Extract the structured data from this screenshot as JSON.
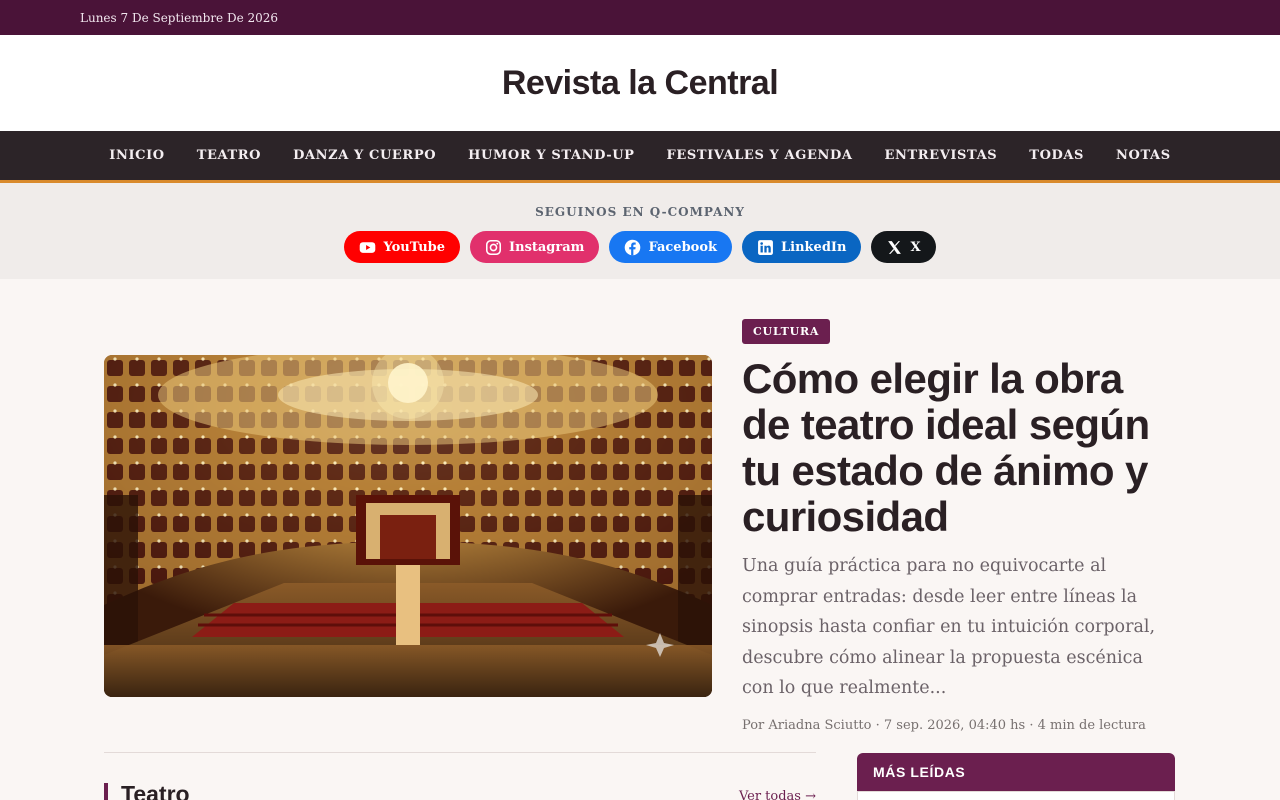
{
  "topbar": {
    "date": "Lunes 7 De Septiembre De 2026"
  },
  "site": {
    "title": "Revista la Central"
  },
  "nav": {
    "items": [
      "INICIO",
      "TEATRO",
      "DANZA Y CUERPO",
      "HUMOR Y STAND-UP",
      "FESTIVALES Y AGENDA",
      "ENTREVISTAS",
      "TODAS",
      "NOTAS"
    ]
  },
  "social": {
    "heading": "SEGUINOS EN Q-COMPANY",
    "links": [
      {
        "label": "YouTube",
        "icon": "youtube-icon",
        "color": "#ff0000"
      },
      {
        "label": "Instagram",
        "icon": "instagram-icon",
        "color": "#e1306c"
      },
      {
        "label": "Facebook",
        "icon": "facebook-icon",
        "color": "#1877f2"
      },
      {
        "label": "LinkedIn",
        "icon": "linkedin-icon",
        "color": "#0a66c2"
      },
      {
        "label": "X",
        "icon": "x-icon",
        "color": "#14171a"
      }
    ]
  },
  "hero": {
    "category": "CULTURA",
    "title": "Cómo elegir la obra de teatro ideal según tu estado de ánimo y curiosidad",
    "excerpt": "Una guía práctica para no equivocarte al comprar entradas: desde leer entre líneas la sinopsis hasta confiar en tu intuición corporal, descubre cómo alinear la propuesta escénica con lo que realmente...",
    "byline": "Por Ariadna Sciutto · 7 sep. 2026, 04:40 hs · 4 min de lectura",
    "image_alt": "theatre-interior-photo"
  },
  "section": {
    "title": "Teatro",
    "see_all": "Ver todas →"
  },
  "sidebar": {
    "popular_title": "MÁS LEÍDAS"
  },
  "colors": {
    "brand": "#6b1f4f",
    "topbar": "#4a1338",
    "nav_bg": "#2c2428",
    "nav_accent": "#d98a2c"
  }
}
